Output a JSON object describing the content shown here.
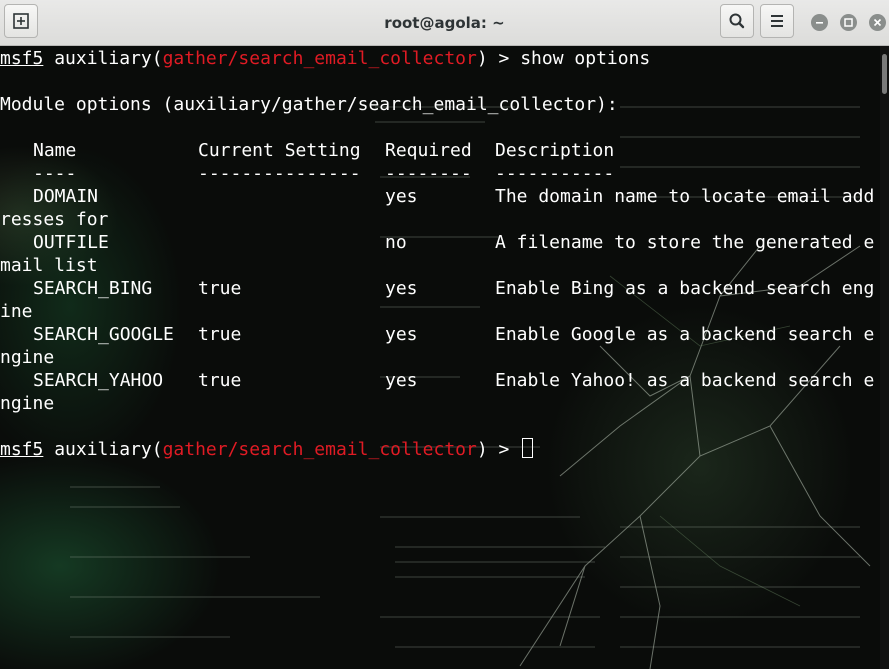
{
  "window": {
    "title": "root@agola: ~",
    "new_tab_icon": "new-tab-icon",
    "search_icon": "search-icon",
    "menu_icon": "hamburger-menu-icon"
  },
  "prompt": {
    "name": "msf5",
    "word": "auxiliary(",
    "module": "gather/search_email_collector",
    "tail": ") > "
  },
  "command": "show options",
  "module_options_line": "Module options (auxiliary/gather/search_email_collector):",
  "table": {
    "headers": [
      "Name",
      "Current Setting",
      "Required",
      "Description"
    ],
    "underlines": [
      "----",
      "---------------",
      "--------",
      "-----------"
    ],
    "rows": [
      {
        "name": "DOMAIN",
        "setting": "",
        "required": "yes",
        "desc": "The domain name to locate email add",
        "wrap": "resses for"
      },
      {
        "name": "OUTFILE",
        "setting": "",
        "required": "no",
        "desc": "A filename to store the generated e",
        "wrap": "mail list"
      },
      {
        "name": "SEARCH_BING",
        "setting": "true",
        "required": "yes",
        "desc": "Enable Bing as a backend search eng",
        "wrap": "ine"
      },
      {
        "name": "SEARCH_GOOGLE",
        "setting": "true",
        "required": "yes",
        "desc": "Enable Google as a backend search e",
        "wrap": "ngine"
      },
      {
        "name": "SEARCH_YAHOO",
        "setting": "true",
        "required": "yes",
        "desc": "Enable Yahoo! as a backend search e",
        "wrap": "ngine"
      }
    ]
  },
  "colors": {
    "module_red": "#e01b24",
    "text": "#ffffff",
    "titlebar": "#e3e3e1"
  }
}
